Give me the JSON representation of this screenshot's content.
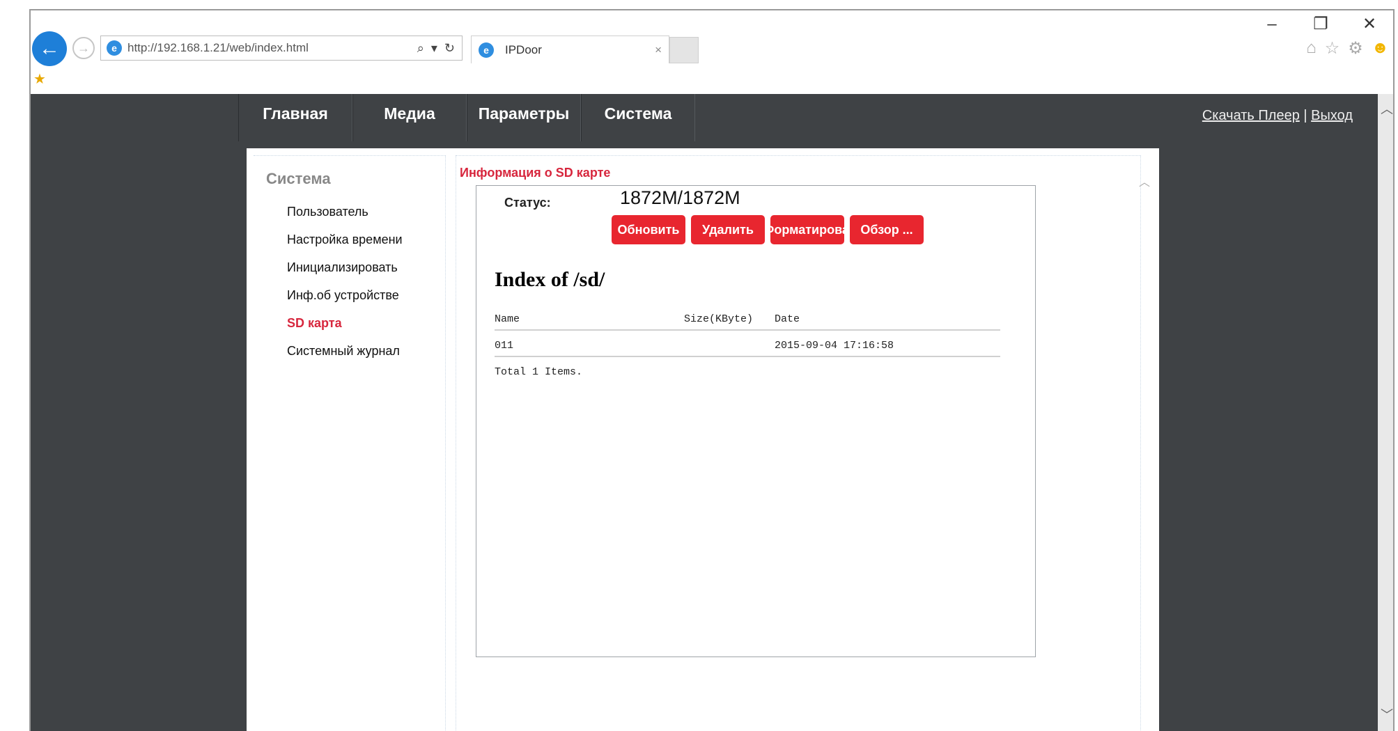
{
  "browser": {
    "url": "http://192.168.1.21/web/index.html",
    "tab_title": "IPDoor",
    "tab_close": "×",
    "window_controls": {
      "minimize": "–",
      "restore": "❐",
      "close": "✕"
    },
    "address_tools": {
      "search": "⌕",
      "dropdown": "▾",
      "refresh": "↻"
    }
  },
  "nav": {
    "items": [
      {
        "label": "Главная"
      },
      {
        "label": "Медиа"
      },
      {
        "label": "Параметры"
      },
      {
        "label": "Система"
      }
    ],
    "download_player": "Скачать Плеер",
    "separator": "|",
    "logout": "Выход"
  },
  "sidebar": {
    "title": "Система",
    "items": [
      {
        "label": "Пользователь"
      },
      {
        "label": "Настройка времени"
      },
      {
        "label": "Инициализировать"
      },
      {
        "label": "Инф.об устройстве"
      },
      {
        "label": "SD карта"
      },
      {
        "label": "Системный журнал"
      }
    ]
  },
  "content": {
    "title": "Информация о SD карте",
    "status_label": "Статус:",
    "status_value": "1872M/1872M",
    "buttons": {
      "refresh": "Обновить",
      "delete": "Удалить",
      "format": "Форматировать",
      "browse": "Обзор ..."
    },
    "listing": {
      "heading": "Index of /sd/",
      "columns": [
        "Name",
        "Size(KByte)",
        "Date"
      ],
      "rows": [
        {
          "name": "011",
          "size": "",
          "date": "2015-09-04 17:16:58"
        }
      ],
      "total": "Total 1 Items."
    }
  }
}
